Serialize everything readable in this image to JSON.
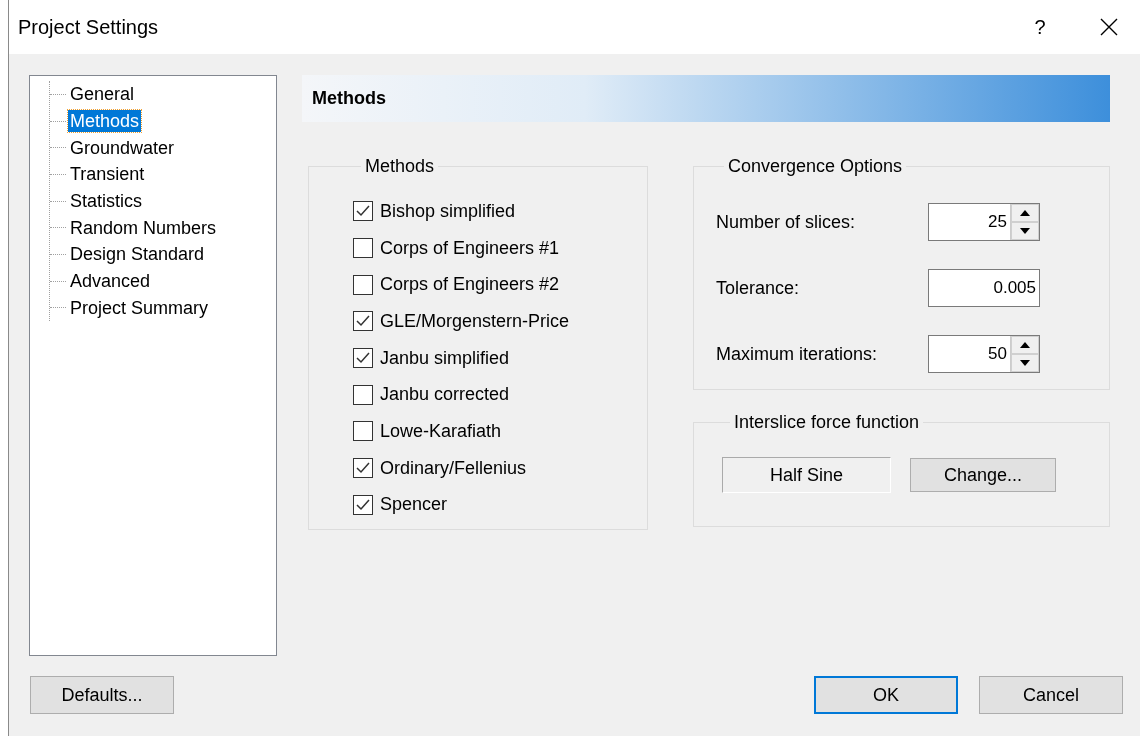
{
  "window": {
    "title": "Project Settings",
    "help": "?"
  },
  "tree": [
    {
      "label": "General",
      "selected": false
    },
    {
      "label": "Methods",
      "selected": true
    },
    {
      "label": "Groundwater",
      "selected": false
    },
    {
      "label": "Transient",
      "selected": false
    },
    {
      "label": "Statistics",
      "selected": false
    },
    {
      "label": "Random Numbers",
      "selected": false
    },
    {
      "label": "Design Standard",
      "selected": false
    },
    {
      "label": "Advanced",
      "selected": false
    },
    {
      "label": "Project Summary",
      "selected": false
    }
  ],
  "page_header": "Methods",
  "methods_group": {
    "title": "Methods",
    "items": [
      {
        "label": "Bishop simplified",
        "checked": true
      },
      {
        "label": "Corps of Engineers #1",
        "checked": false
      },
      {
        "label": "Corps of Engineers #2",
        "checked": false
      },
      {
        "label": "GLE/Morgenstern-Price",
        "checked": true
      },
      {
        "label": "Janbu simplified",
        "checked": true
      },
      {
        "label": "Janbu corrected",
        "checked": false
      },
      {
        "label": "Lowe-Karafiath",
        "checked": false
      },
      {
        "label": "Ordinary/Fellenius",
        "checked": true
      },
      {
        "label": "Spencer",
        "checked": true
      }
    ]
  },
  "convergence": {
    "title": "Convergence Options",
    "fields": [
      {
        "label": "Number of slices:",
        "value": "25",
        "kind": "spin"
      },
      {
        "label": "Tolerance:",
        "value": "0.005",
        "kind": "text"
      },
      {
        "label": "Maximum iterations:",
        "value": "50",
        "kind": "spin"
      }
    ]
  },
  "interslice": {
    "title": "Interslice force function",
    "value": "Half Sine",
    "button": "Change..."
  },
  "footer": {
    "left_buttons": [
      {
        "label": "Defaults...",
        "focused": false
      }
    ],
    "right_buttons": [
      {
        "label": "OK",
        "focused": true
      },
      {
        "label": "Cancel",
        "focused": false
      }
    ]
  }
}
